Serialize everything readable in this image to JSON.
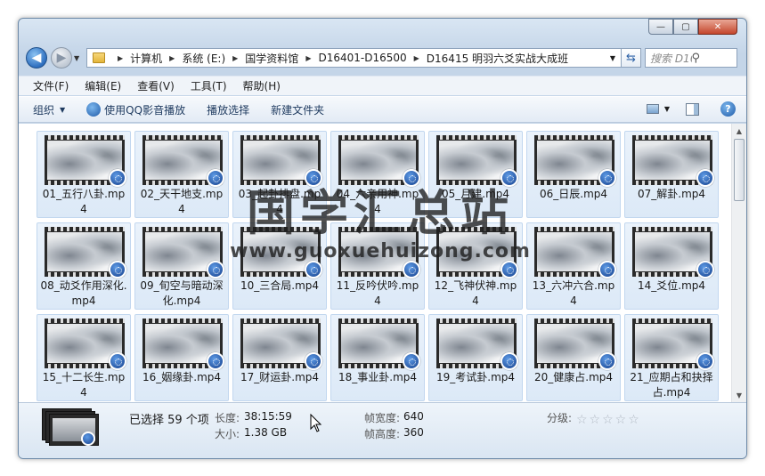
{
  "window": {
    "minimize": "—",
    "maximize": "▢",
    "close": "✕"
  },
  "address": {
    "crumbs": [
      "计算机",
      "系统 (E:)",
      "国学资料馆",
      "D16401-D16500",
      "D16415 明羽六爻实战大成班"
    ],
    "search_placeholder": "搜索 D164..."
  },
  "menu": [
    "文件(F)",
    "编辑(E)",
    "查看(V)",
    "工具(T)",
    "帮助(H)"
  ],
  "toolbar": {
    "organize": "组织",
    "qq_play": "使用QQ影音播放",
    "play_selection": "播放选择",
    "new_folder": "新建文件夹"
  },
  "files": [
    "01_五行八卦.mp4",
    "02_天干地支.mp4",
    "03_起卦排盘.mp4",
    "04_六亲用神.mp4",
    "05_月建.mp4",
    "06_日辰.mp4",
    "07_解卦.mp4",
    "08_动爻作用深化.mp4",
    "09_旬空与暗动深化.mp4",
    "10_三合局.mp4",
    "11_反吟伏吟.mp4",
    "12_飞神伏神.mp4",
    "13_六冲六合.mp4",
    "14_爻位.mp4",
    "15_十二长生.mp4",
    "16_姻缘卦.mp4",
    "17_财运卦.mp4",
    "18_事业卦.mp4",
    "19_考试卦.mp4",
    "20_健康占.mp4",
    "21_应期占和抉择占.mp4"
  ],
  "details": {
    "selected": "已选择 59 个项",
    "length_label": "长度:",
    "length_value": "38:15:59",
    "size_label": "大小:",
    "size_value": "1.38 GB",
    "width_label": "帧宽度:",
    "width_value": "640",
    "height_label": "帧高度:",
    "height_value": "360",
    "rating_label": "分级:",
    "rating_stars": "☆☆☆☆☆",
    "rating": 0
  },
  "watermark": {
    "title": "国学汇总站",
    "url": "www.guoxuehuizong.com"
  }
}
